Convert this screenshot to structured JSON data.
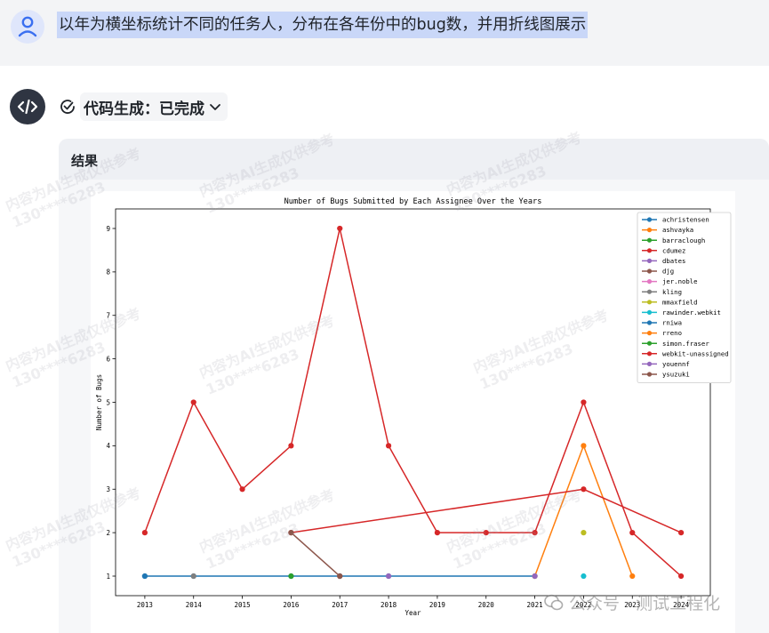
{
  "conversation": {
    "user_prompt": "以年为横坐标统计不同的任务人，分布在各年份中的bug数，并用折线图展示",
    "status_label": "代码生成：已完成",
    "result_title": "结果"
  },
  "watermark": {
    "text_line1": "内容为AI生成仅供参考",
    "text_line2": "130****6283"
  },
  "footer": {
    "label": "公众号 · 测试工程化"
  },
  "chart_data": {
    "type": "line",
    "title": "Number of Bugs Submitted by Each Assignee Over the Years",
    "xlabel": "Year",
    "ylabel": "Number of Bugs",
    "x_ticks": [
      2013,
      2014,
      2015,
      2016,
      2017,
      2018,
      2019,
      2020,
      2021,
      2022,
      2023,
      2024
    ],
    "y_ticks": [
      1,
      2,
      3,
      4,
      5,
      6,
      7,
      8,
      9
    ],
    "xlim": [
      2012.4,
      2024.6
    ],
    "ylim": [
      0.55,
      9.45
    ],
    "legend_position": "top-right",
    "series": [
      {
        "name": "achristensen",
        "color": "#1f77b4",
        "x": [
          2013,
          2014,
          2016,
          2017,
          2018,
          2021
        ],
        "y": [
          1,
          1,
          1,
          1,
          1,
          1
        ]
      },
      {
        "name": "ashvayka",
        "color": "#ff7f0e",
        "x": [
          2021,
          2022,
          2023
        ],
        "y": [
          1,
          4,
          1
        ]
      },
      {
        "name": "barraclough",
        "color": "#2ca02c",
        "x": [
          2016
        ],
        "y": [
          1
        ]
      },
      {
        "name": "cdumez",
        "color": "#d62728",
        "x": [
          2016,
          2022,
          2024
        ],
        "y": [
          2,
          3,
          2
        ]
      },
      {
        "name": "dbates",
        "color": "#9467bd",
        "x": [
          2018
        ],
        "y": [
          1
        ]
      },
      {
        "name": "djg",
        "color": "#8c564b",
        "x": [
          2016,
          2017
        ],
        "y": [
          2,
          1
        ]
      },
      {
        "name": "jer.noble",
        "color": "#e377c2",
        "x": [],
        "y": []
      },
      {
        "name": "kling",
        "color": "#7f7f7f",
        "x": [
          2014
        ],
        "y": [
          1
        ]
      },
      {
        "name": "mmaxfield",
        "color": "#bcbd22",
        "x": [
          2022
        ],
        "y": [
          2
        ]
      },
      {
        "name": "rawinder.webkit",
        "color": "#17becf",
        "x": [
          2022
        ],
        "y": [
          1
        ]
      },
      {
        "name": "rniwa",
        "color": "#1f77b4",
        "x": [
          2013
        ],
        "y": [
          1
        ]
      },
      {
        "name": "rreno",
        "color": "#ff7f0e",
        "x": [],
        "y": []
      },
      {
        "name": "simon.fraser",
        "color": "#2ca02c",
        "x": [],
        "y": []
      },
      {
        "name": "webkit-unassigned",
        "color": "#d62728",
        "x": [
          2013,
          2014,
          2015,
          2016,
          2017,
          2018,
          2019,
          2020,
          2021,
          2022,
          2023,
          2024
        ],
        "y": [
          2,
          5,
          3,
          4,
          9,
          4,
          2,
          2,
          2,
          5,
          2,
          1
        ]
      },
      {
        "name": "youennf",
        "color": "#9467bd",
        "x": [
          2021
        ],
        "y": [
          1
        ]
      },
      {
        "name": "ysuzuki",
        "color": "#8c564b",
        "x": [
          2017
        ],
        "y": [
          1
        ]
      }
    ]
  }
}
